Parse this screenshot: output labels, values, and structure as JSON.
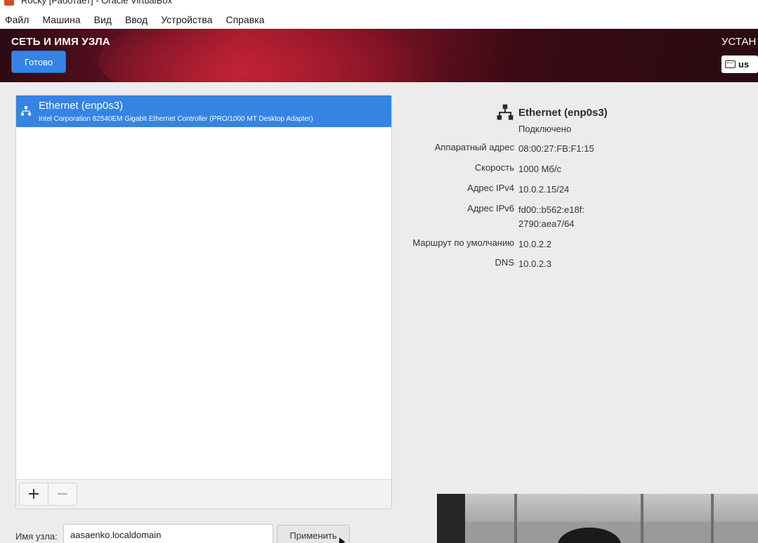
{
  "window": {
    "title": "Rocky [Работает] - Oracle VirtualBox"
  },
  "menubar": {
    "items": [
      "Файл",
      "Машина",
      "Вид",
      "Ввод",
      "Устройства",
      "Справка"
    ]
  },
  "header": {
    "page_title": "СЕТЬ И ИМЯ УЗЛА",
    "done_label": "Готово",
    "install_title": "УСТАН",
    "keyboard_layout": "us"
  },
  "devices": [
    {
      "name": "Ethernet (enp0s3)",
      "description": "Intel Corporation 82540EM Gigabit Ethernet Controller (PRO/1000 MT Desktop Adapter)",
      "selected": true
    }
  ],
  "list_toolbar": {
    "add_label": "+",
    "remove_label": "−"
  },
  "details": {
    "title": "Ethernet (enp0s3)",
    "status": "Подключено",
    "rows": [
      {
        "label": "Аппаратный адрес",
        "value": "08:00:27:FB:F1:15"
      },
      {
        "label": "Скорость",
        "value": "1000 Мб/с"
      },
      {
        "label": "Адрес IPv4",
        "value": "10.0.2.15/24"
      },
      {
        "label": "Адрес IPv6",
        "value": "fd00::b562:e18f:\n2790:aea7/64"
      },
      {
        "label": "Маршрут по умолчанию",
        "value": "10.0.2.2"
      },
      {
        "label": "DNS",
        "value": "10.0.2.3"
      }
    ]
  },
  "hostname": {
    "label": "Имя узла:",
    "value": "aasaenko.localdomain",
    "apply_label": "Применить"
  },
  "colors": {
    "accent": "#3584e4",
    "header_dark": "#2a0a12",
    "header_red": "#a31a2e"
  }
}
